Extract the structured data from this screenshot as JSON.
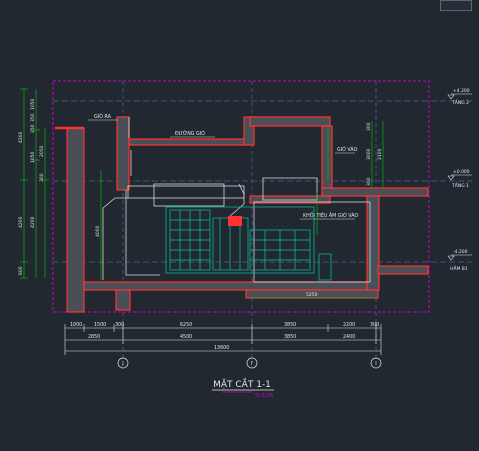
{
  "drawing": {
    "title": "MẶT CẮT 1-1",
    "scale": "TL:1/35"
  },
  "labels": {
    "air_out": "GIÓ RA",
    "air_duct": "ĐƯỜNG GIÓ",
    "air_in": "GIÓ VÀO",
    "silencer": "KHỐI TIÊU ÂM GIÓ VÀO"
  },
  "levels": [
    {
      "value": "+4.200",
      "name": "TẦNG 2"
    },
    {
      "value": "±0.000",
      "name": "TẦNG 1"
    },
    {
      "value": "-4.200",
      "name": "HẦM B1"
    }
  ],
  "left_dims": {
    "outer": [
      "4200",
      "4200",
      "600"
    ],
    "inner": [
      "1050",
      "350",
      "250",
      "1050",
      "4200"
    ],
    "small": [
      "300",
      "2050"
    ]
  },
  "inner_dims": {
    "room_height": "4000",
    "upper": [
      "300",
      "3000",
      "2100",
      "300"
    ],
    "floor_len": "5250"
  },
  "bottom_dims": {
    "row1": [
      "1000",
      "1500",
      "300",
      "6250",
      "3850",
      "2200",
      "300"
    ],
    "row2": [
      "2850",
      "4500",
      "3850",
      "2400"
    ],
    "total": "13600"
  },
  "grid_axes": [
    "J",
    "I'",
    "I"
  ],
  "colors": {
    "background": "#212830",
    "wall": "#ff3333",
    "border": "#cc00cc",
    "dimension": "#00cc00",
    "equipment": "#00c8a0",
    "text": "#e6e6e6"
  }
}
